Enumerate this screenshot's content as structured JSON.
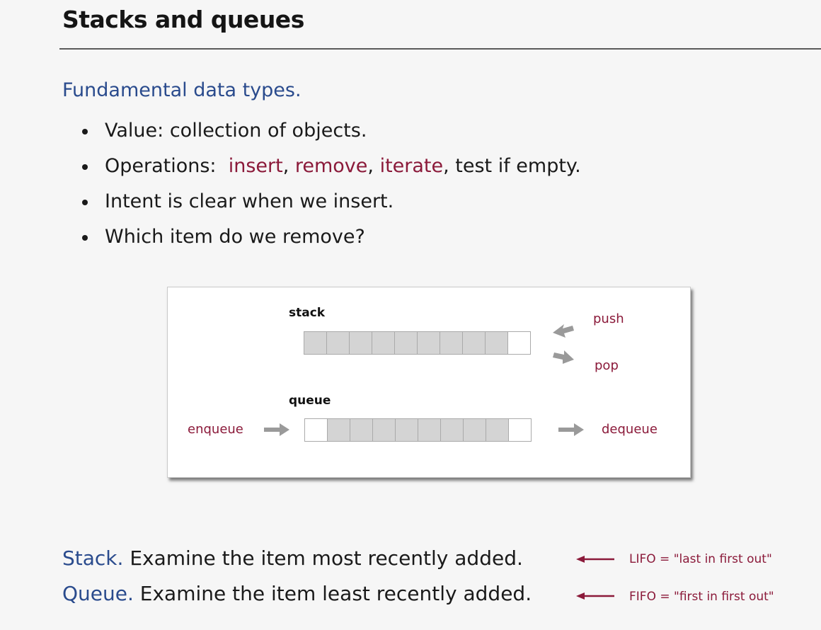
{
  "slide": {
    "title": "Stacks and queues",
    "section_head": "Fundamental data types.",
    "bullets": {
      "b1": "Value: collection of objects.",
      "b2_prefix": "Operations:  ",
      "b2_insert": "insert",
      "b2_sep1": ", ",
      "b2_remove": "remove",
      "b2_sep2": ", ",
      "b2_iterate": "iterate",
      "b2_suffix": ", test if empty.",
      "b3": "Intent is clear when we insert.",
      "b4": "Which item do we remove?"
    },
    "figure": {
      "stack_label": "stack",
      "push_label": "push",
      "pop_label": "pop",
      "queue_label": "queue",
      "enqueue_label": "enqueue",
      "dequeue_label": "dequeue"
    },
    "stack_line": {
      "keyword": "Stack.",
      "text": " Examine the item most recently added.",
      "note": "LIFO = \"last in first out\""
    },
    "queue_line": {
      "keyword": "Queue.",
      "text": " Examine the item least recently added.",
      "note": "FIFO = \"first in first out\""
    }
  },
  "colors": {
    "heading_blue": "#2a4b8d",
    "operation_red": "#8b1a3a",
    "cell_fill": "#d4d4d4",
    "arrow_gray": "#9a9a9a"
  },
  "icons": [
    "push-arrow-icon",
    "pop-arrow-icon",
    "enqueue-arrow-icon",
    "dequeue-arrow-icon",
    "left-arrow-icon"
  ]
}
